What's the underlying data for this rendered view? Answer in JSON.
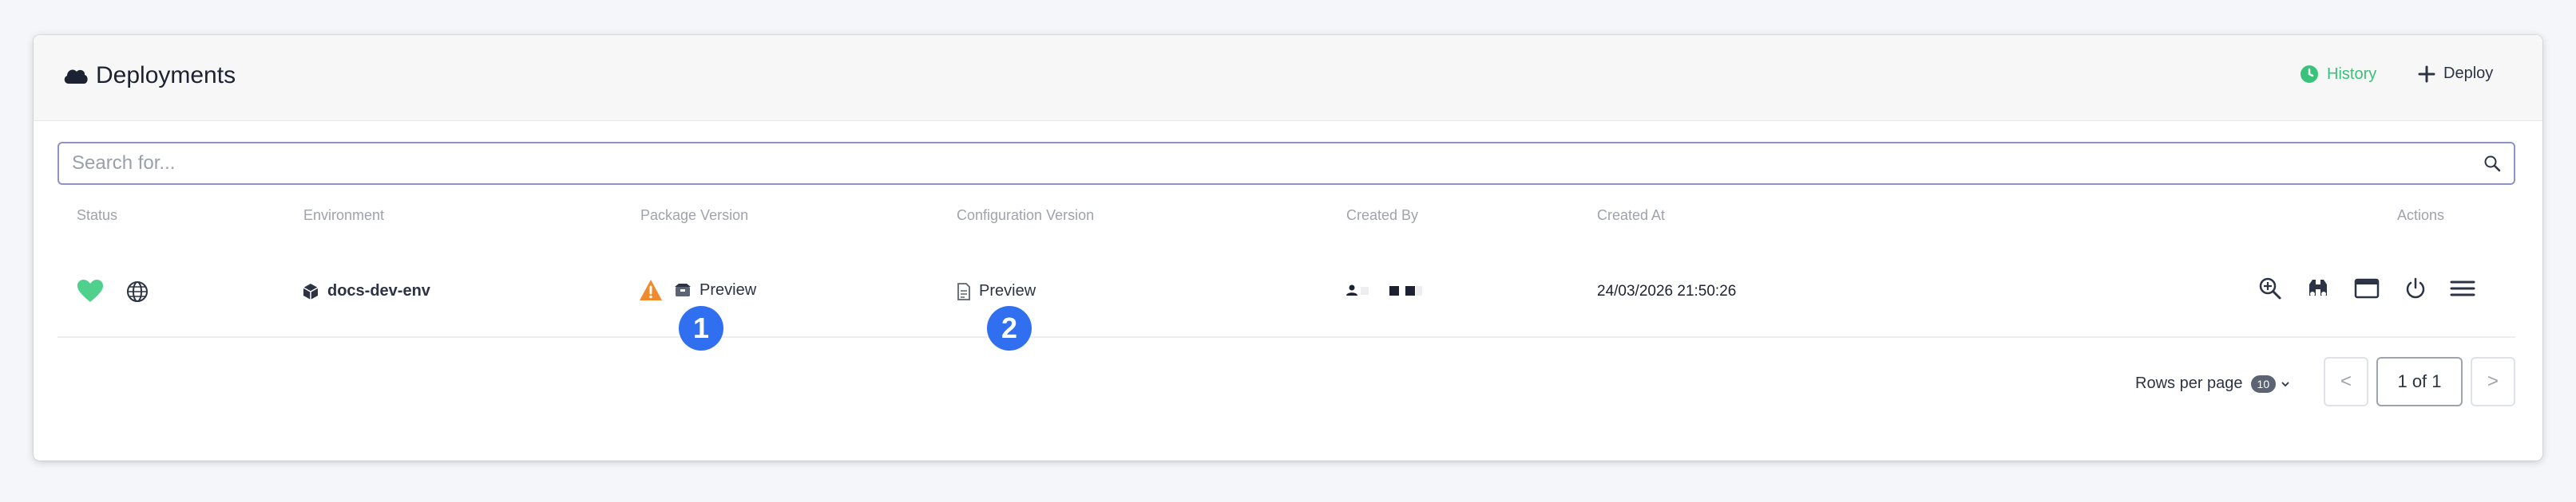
{
  "header": {
    "title": "Deployments",
    "history_label": "History",
    "deploy_label": "Deploy"
  },
  "search": {
    "placeholder": "Search for..."
  },
  "table": {
    "columns": [
      "Status",
      "Environment",
      "Package Version",
      "Configuration Version",
      "Created By",
      "Created At",
      "Actions"
    ],
    "rows": [
      {
        "status_icon": "heart-icon",
        "scope_icon": "globe-icon",
        "environment": "docs-dev-env",
        "package_version": "Preview",
        "package_warning": "warning-icon",
        "configuration_version": "Preview",
        "created_at": "24/03/2026 21:50:26"
      }
    ]
  },
  "annotations": {
    "badge_1": "1",
    "badge_2": "2"
  },
  "pagination": {
    "rows_per_page_label": "Rows per page",
    "rows_per_page_value": "10",
    "page_indicator": "1 of 1",
    "prev_label": "<",
    "next_label": ">"
  },
  "colors": {
    "accent_green": "#39c27a",
    "heart": "#4fd08c",
    "warning": "#ef8a2f",
    "badge_blue": "#2f6ff0",
    "search_border": "#8d93c2"
  }
}
